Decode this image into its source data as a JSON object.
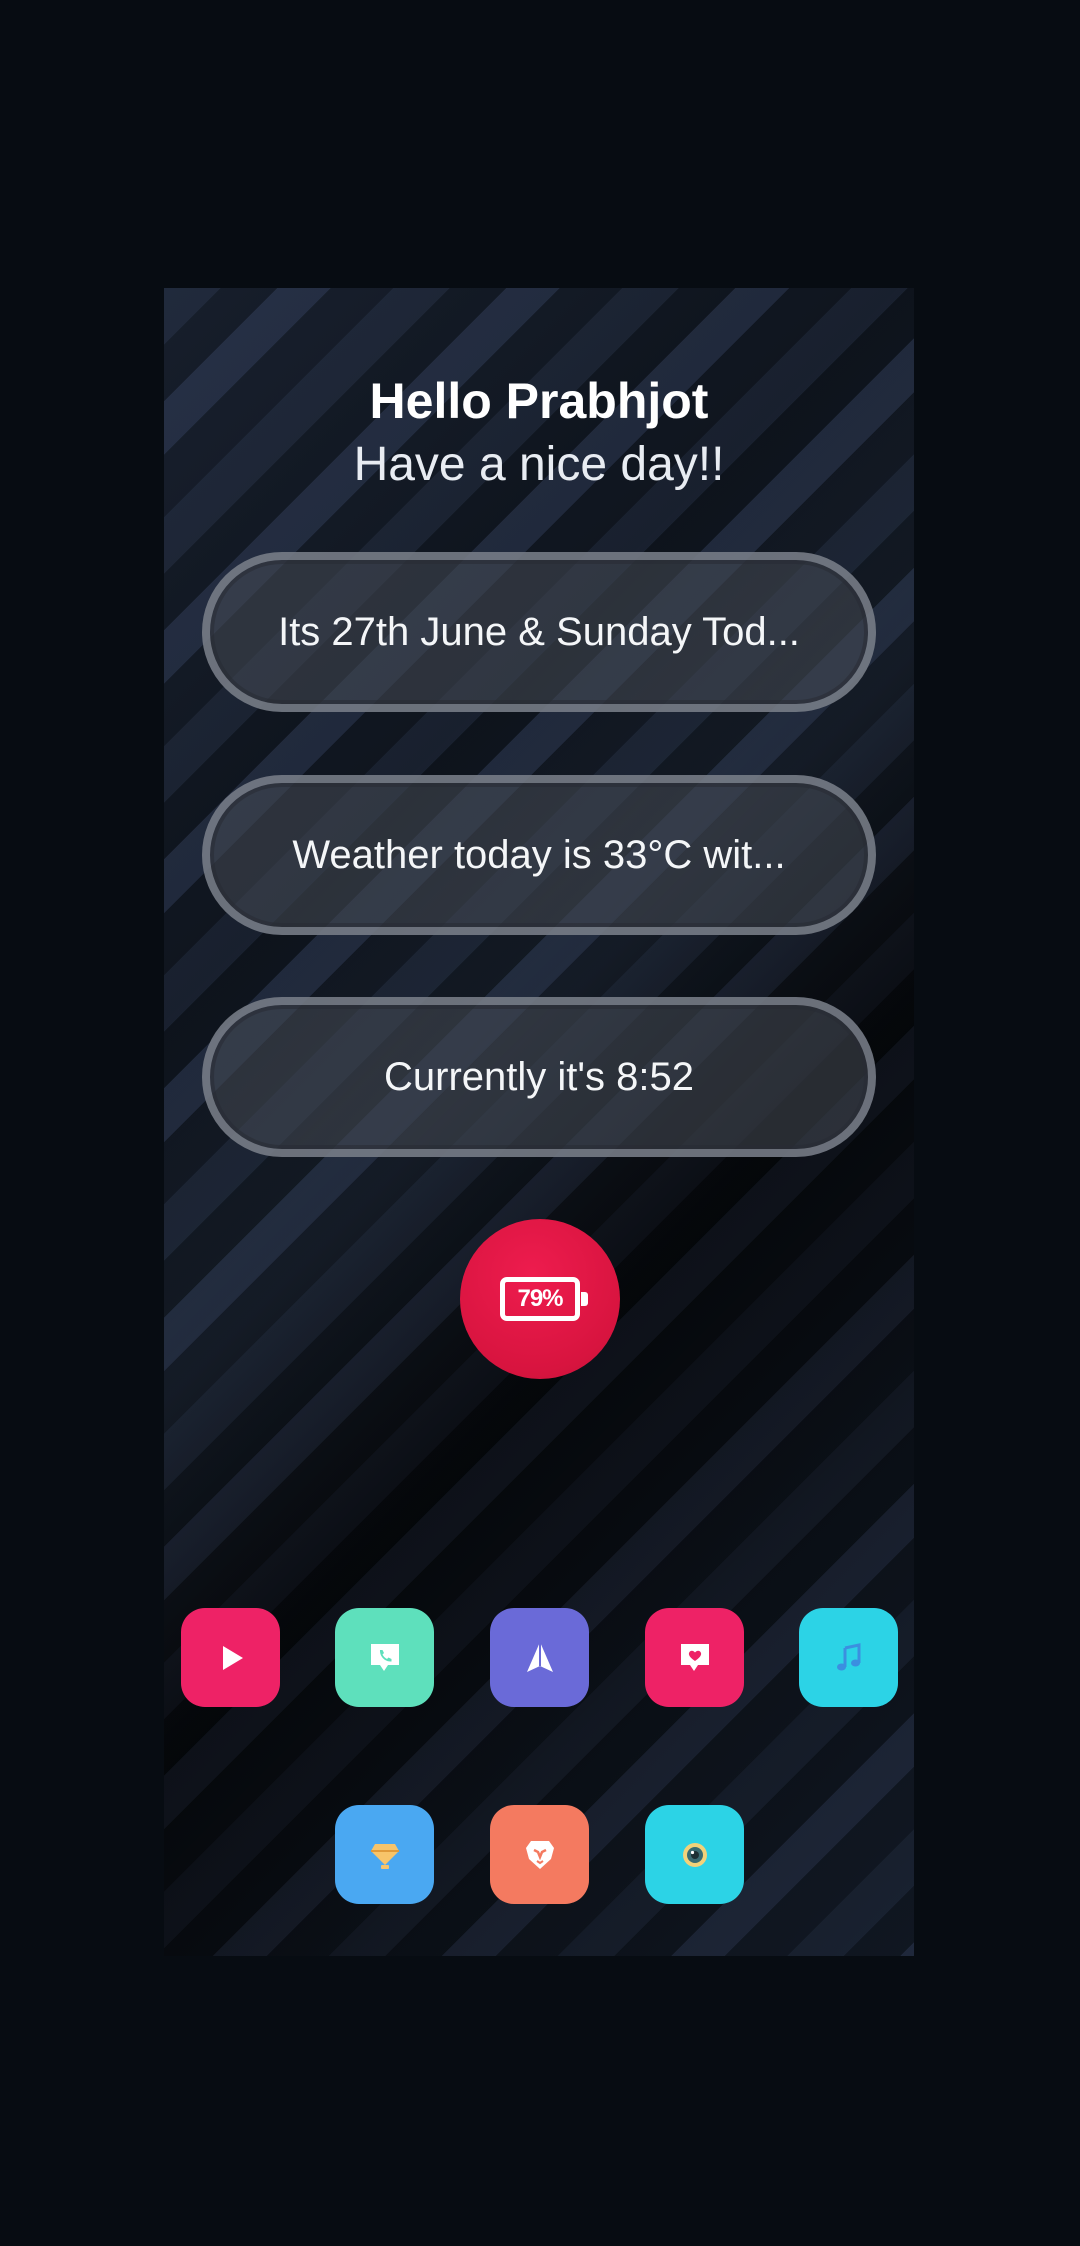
{
  "greeting": {
    "title": "Hello Prabhjot",
    "subtitle": "Have a nice day!!"
  },
  "info_pills": [
    {
      "text": "Its 27th June & Sunday Tod..."
    },
    {
      "text": "Weather today is 33°C wit..."
    },
    {
      "text": "Currently it's 8:52"
    }
  ],
  "battery": {
    "label": "79%",
    "icon": "battery-icon",
    "color": "#e0154a"
  },
  "dock_row1": [
    {
      "icon": "play-icon",
      "color": "#ee2266"
    },
    {
      "icon": "phone-chat-icon",
      "color": "#5ee0bc"
    },
    {
      "icon": "paper-plane-icon",
      "color": "#6a6ad8"
    },
    {
      "icon": "heart-chat-icon",
      "color": "#ee2266"
    },
    {
      "icon": "music-note-icon",
      "color": "#2cd3e6"
    }
  ],
  "dock_row2": [
    {
      "icon": "diamond-icon",
      "color": "#4aa8f2"
    },
    {
      "icon": "lion-icon",
      "color": "#f47a60"
    },
    {
      "icon": "camera-lens-icon",
      "color": "#2cd3e6"
    }
  ]
}
